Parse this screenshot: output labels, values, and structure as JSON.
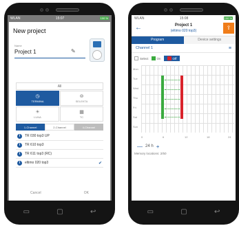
{
  "left": {
    "status": {
      "carrier": "WLAN",
      "time": "15:07",
      "battery": "100 %"
    },
    "dialog": {
      "title": "New project",
      "name_label": "Name",
      "name_value": "Project 1",
      "all_label": "All",
      "types": [
        {
          "label": "TERMINA",
          "icon": "clock-icon",
          "active": true
        },
        {
          "label": "SELEKTA",
          "icon": "dial-icon",
          "active": false
        },
        {
          "label": "LUNA",
          "icon": "sun-icon",
          "active": false
        },
        {
          "label": "TC",
          "icon": "calendar-icon",
          "active": false
        }
      ],
      "channels": [
        "1-Channel",
        "2-Channel",
        "4-Channel"
      ],
      "devices": [
        {
          "name": "TR 030 top3 UP",
          "checked": false
        },
        {
          "name": "TR 610 top3",
          "checked": false
        },
        {
          "name": "TR 611 top3 (RC)",
          "checked": false
        },
        {
          "name": "eltimo 020 top3",
          "checked": true
        }
      ],
      "cancel": "Cancel",
      "ok": "OK"
    }
  },
  "right": {
    "status": {
      "carrier": "WLAN",
      "time": "15:08",
      "battery": "100 %"
    },
    "title": "Project 1",
    "subtitle": "(eltimo 020 top3)",
    "tabs": [
      "Program",
      "Device settings"
    ],
    "channel": "Channel 1",
    "legend": {
      "select": "Select",
      "on": "On",
      "off": "Off"
    },
    "days": [
      "Mon",
      "Tue",
      "Wed",
      "Thu",
      "Fri",
      "Sat",
      "Sun"
    ],
    "axis": [
      "0",
      "6",
      "12",
      "18",
      "24"
    ],
    "zoom_minus": "—",
    "zoom_value": "24 h",
    "zoom_plus": "+",
    "memory": "Memory locations: 2/50",
    "colors": {
      "on": "#3bab3f",
      "off": "#d9232b",
      "accent": "#1e5aa0",
      "upload": "#f07d1a"
    }
  }
}
